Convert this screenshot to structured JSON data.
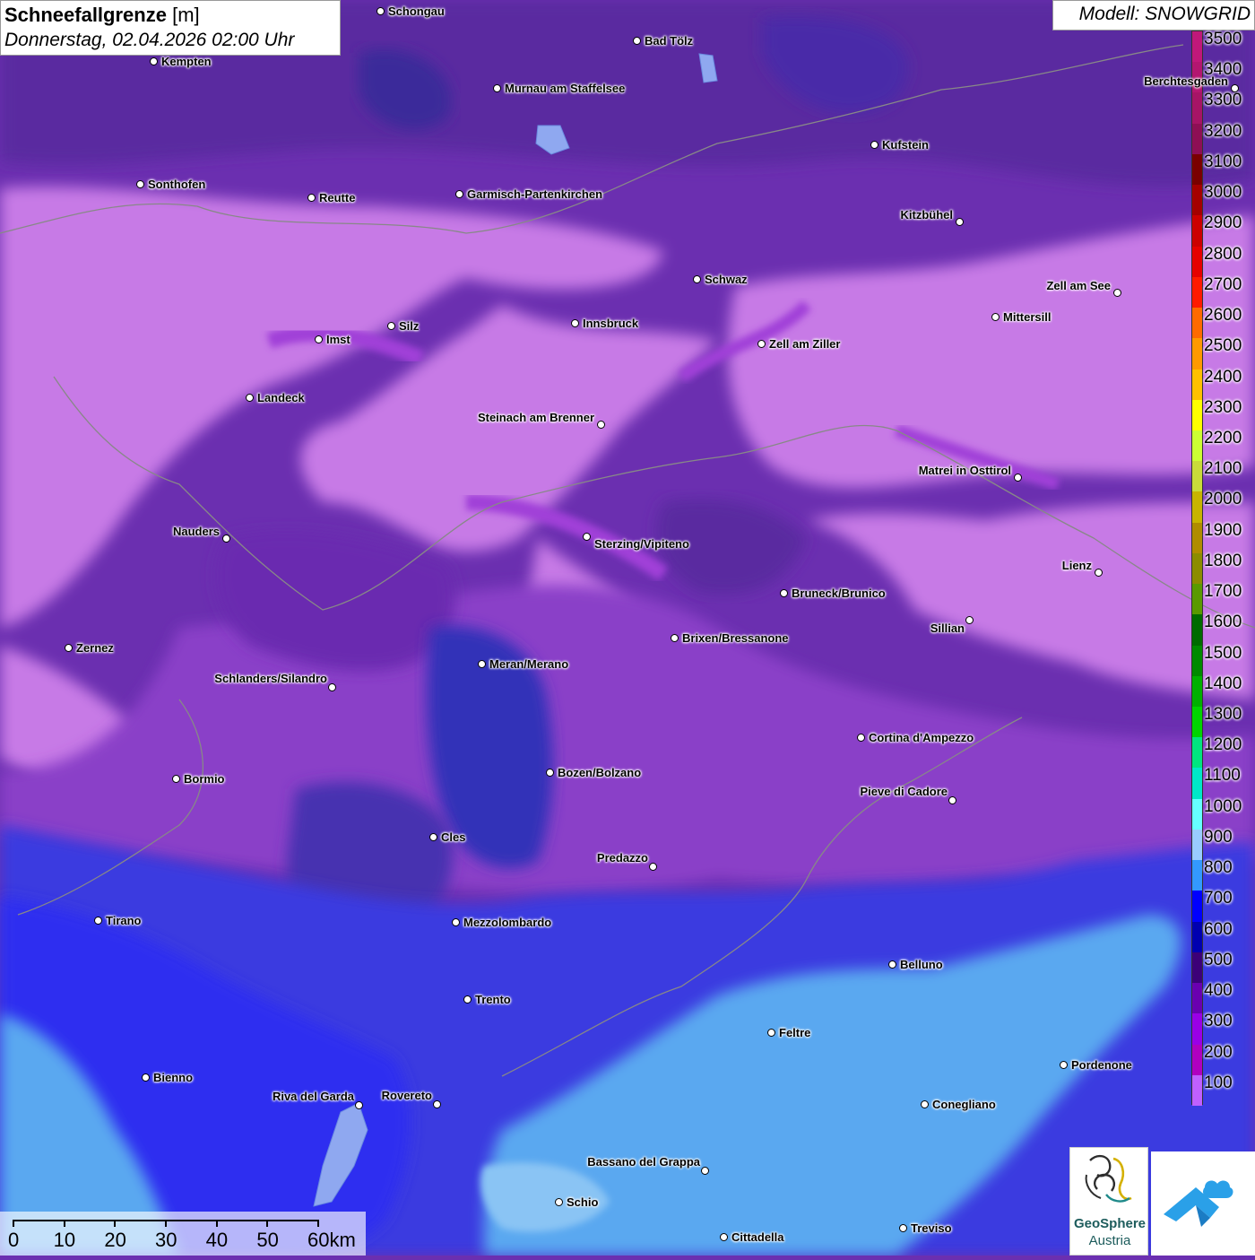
{
  "header": {
    "title_bold": "Schneefallgrenze",
    "title_unit": "[m]",
    "datetime": "Donnerstag, 02.04.2026 02:00 Uhr"
  },
  "model_label": "Modell: SNOWGRID",
  "legend": [
    {
      "label": "3500",
      "color": "#c0187a"
    },
    {
      "label": "3400",
      "color": "#b31670"
    },
    {
      "label": "3300",
      "color": "#a61466"
    },
    {
      "label": "3200",
      "color": "#8e0f55"
    },
    {
      "label": "3100",
      "color": "#7a0000"
    },
    {
      "label": "3000",
      "color": "#a50000"
    },
    {
      "label": "2900",
      "color": "#cc0000"
    },
    {
      "label": "2800",
      "color": "#e60000"
    },
    {
      "label": "2700",
      "color": "#ff1a00"
    },
    {
      "label": "2600",
      "color": "#ff6a00"
    },
    {
      "label": "2500",
      "color": "#ff9900"
    },
    {
      "label": "2400",
      "color": "#ffc000"
    },
    {
      "label": "2300",
      "color": "#ffff00"
    },
    {
      "label": "2200",
      "color": "#ccff33"
    },
    {
      "label": "2100",
      "color": "#c9db3a"
    },
    {
      "label": "2000",
      "color": "#c8b400"
    },
    {
      "label": "1900",
      "color": "#b08c00"
    },
    {
      "label": "1800",
      "color": "#8c8c00"
    },
    {
      "label": "1700",
      "color": "#5a9a00"
    },
    {
      "label": "1600",
      "color": "#006b00"
    },
    {
      "label": "1500",
      "color": "#008a00"
    },
    {
      "label": "1400",
      "color": "#00b000"
    },
    {
      "label": "1300",
      "color": "#00d400"
    },
    {
      "label": "1200",
      "color": "#00e57f"
    },
    {
      "label": "1100",
      "color": "#00e8c8"
    },
    {
      "label": "1000",
      "color": "#66ffff"
    },
    {
      "label": "900",
      "color": "#99ccff"
    },
    {
      "label": "800",
      "color": "#3399ff"
    },
    {
      "label": "700",
      "color": "#0000ff"
    },
    {
      "label": "600",
      "color": "#0000b0"
    },
    {
      "label": "500",
      "color": "#3c0078"
    },
    {
      "label": "400",
      "color": "#6a00b0"
    },
    {
      "label": "300",
      "color": "#9a00e6"
    },
    {
      "label": "200",
      "color": "#b000c0"
    },
    {
      "label": "100",
      "color": "#c060ff"
    }
  ],
  "cities": [
    {
      "name": "Schongau"
    },
    {
      "name": "Bad Tölz"
    },
    {
      "name": "Kempten"
    },
    {
      "name": "Murnau am Staffelsee"
    },
    {
      "name": "Berchtesgaden"
    },
    {
      "name": "Kufstein"
    },
    {
      "name": "Sonthofen"
    },
    {
      "name": "Reutte"
    },
    {
      "name": "Garmisch-Partenkirchen"
    },
    {
      "name": "Kitzbühel"
    },
    {
      "name": "Schwaz"
    },
    {
      "name": "Zell am See"
    },
    {
      "name": "Innsbruck"
    },
    {
      "name": "Mittersill"
    },
    {
      "name": "Imst"
    },
    {
      "name": "Silz"
    },
    {
      "name": "Zell am Ziller"
    },
    {
      "name": "Landeck"
    },
    {
      "name": "Steinach am Brenner"
    },
    {
      "name": "Matrei in Osttirol"
    },
    {
      "name": "Nauders"
    },
    {
      "name": "Sterzing/Vipiteno"
    },
    {
      "name": "Lienz"
    },
    {
      "name": "Bruneck/Brunico"
    },
    {
      "name": "Sillian"
    },
    {
      "name": "Brixen/Bressanone"
    },
    {
      "name": "Zernez"
    },
    {
      "name": "Meran/Merano"
    },
    {
      "name": "Schlanders/Silandro"
    },
    {
      "name": "Cortina d'Ampezzo"
    },
    {
      "name": "Bozen/Bolzano"
    },
    {
      "name": "Bormio"
    },
    {
      "name": "Pieve di Cadore"
    },
    {
      "name": "Cles"
    },
    {
      "name": "Predazzo"
    },
    {
      "name": "Tirano"
    },
    {
      "name": "Mezzolombardo"
    },
    {
      "name": "Belluno"
    },
    {
      "name": "Trento"
    },
    {
      "name": "Feltre"
    },
    {
      "name": "Pordenone"
    },
    {
      "name": "Bienno"
    },
    {
      "name": "Riva del Garda"
    },
    {
      "name": "Rovereto"
    },
    {
      "name": "Conegliano"
    },
    {
      "name": "Bassano del Grappa"
    },
    {
      "name": "Schio"
    },
    {
      "name": "Treviso"
    },
    {
      "name": "Cittadella"
    }
  ],
  "scale_bar": {
    "labels": [
      "0",
      "10",
      "20",
      "30",
      "40",
      "50",
      "60km"
    ]
  },
  "logo": {
    "line1": "GeoSphere",
    "line2": "Austria"
  }
}
